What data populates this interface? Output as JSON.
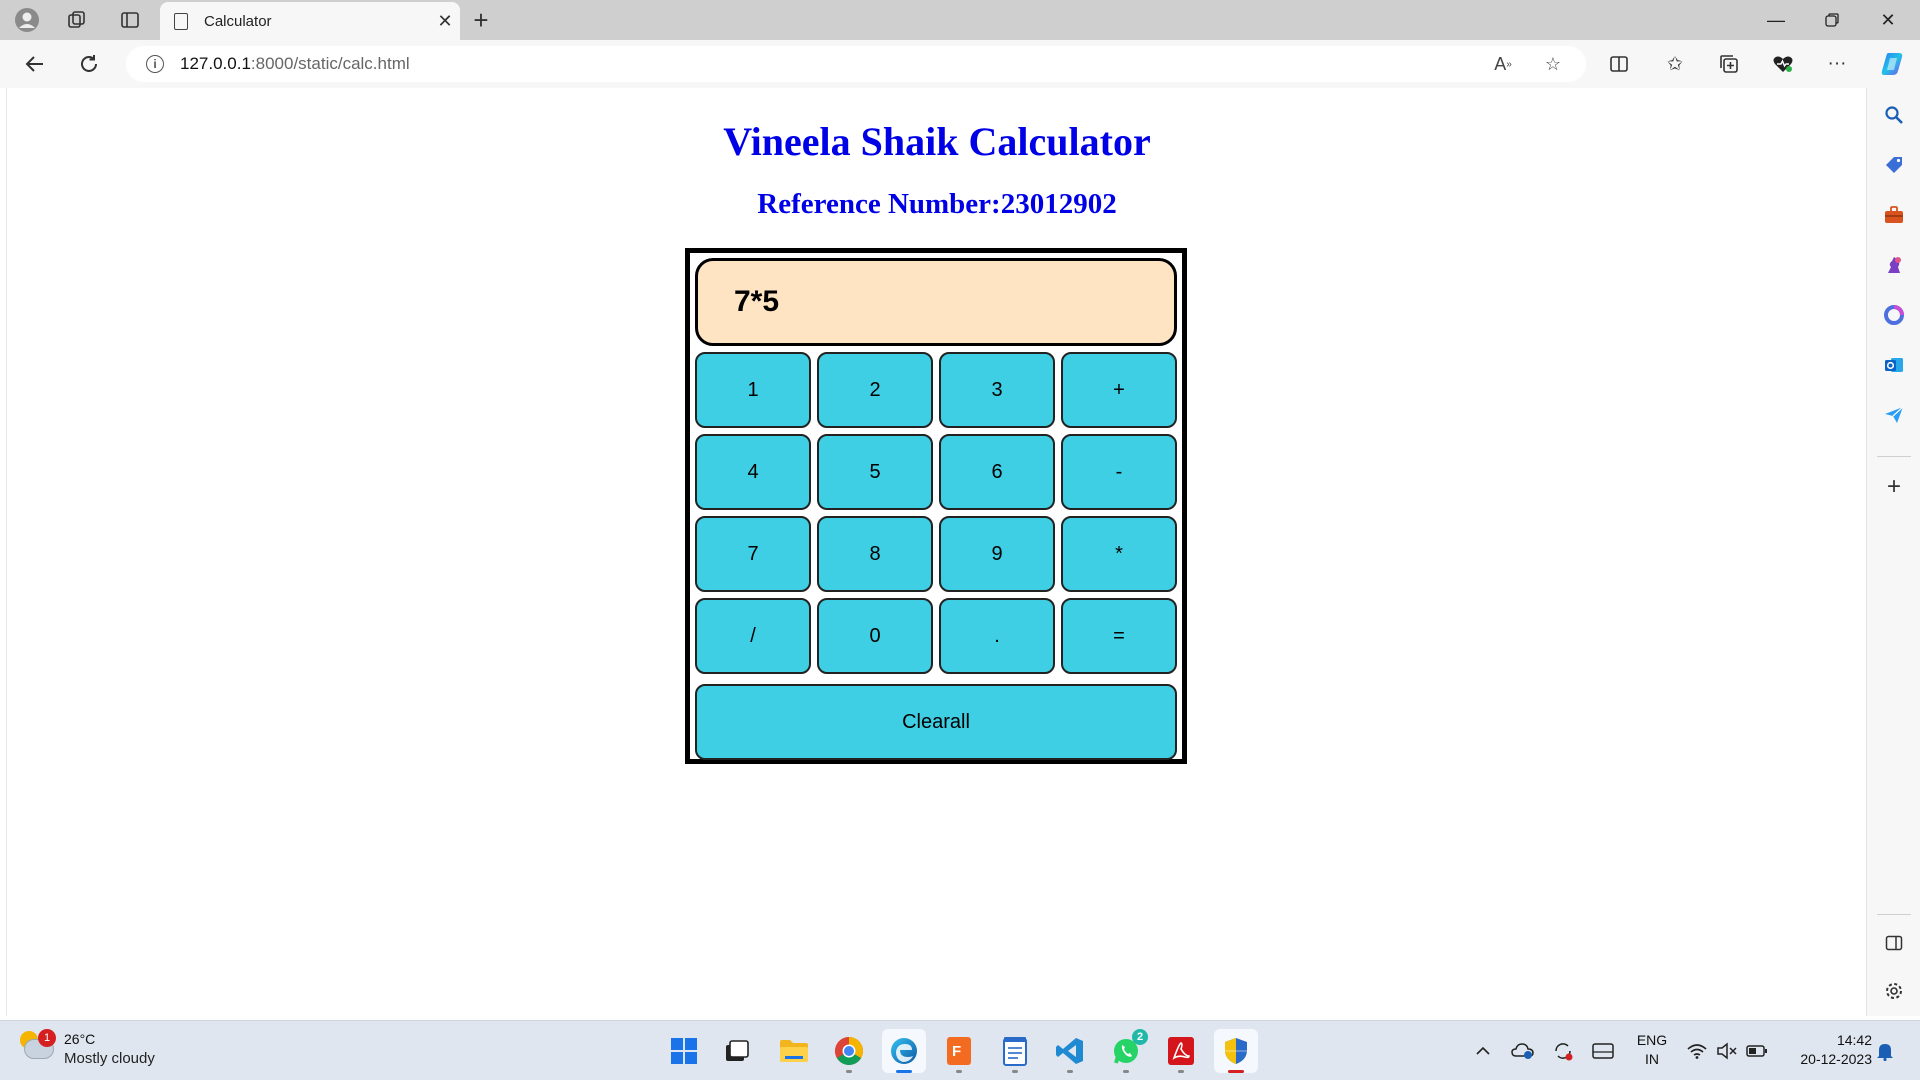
{
  "browser": {
    "tab_title": "Calculator",
    "url_host": "127.0.0.1",
    "url_path": ":8000/static/calc.html"
  },
  "page": {
    "heading": "Vineela Shaik Calculator",
    "reference": "Reference Number:23012902"
  },
  "calculator": {
    "display": "7*5",
    "keys": [
      "1",
      "2",
      "3",
      "+",
      "4",
      "5",
      "6",
      "-",
      "7",
      "8",
      "9",
      "*",
      "/",
      "0",
      ".",
      "="
    ],
    "clear_label": "Clearall",
    "key_color": "#3ecfe4",
    "display_color": "#ffe4c4"
  },
  "taskbar": {
    "weather_temp": "26°C",
    "weather_condition": "Mostly cloudy",
    "weather_badge": "1",
    "whatsapp_badge": "2",
    "lang_top": "ENG",
    "lang_bottom": "IN",
    "time": "14:42",
    "date": "20-12-2023"
  },
  "colors": {
    "heading": "#0000e6",
    "accent": "#1a73e8"
  }
}
